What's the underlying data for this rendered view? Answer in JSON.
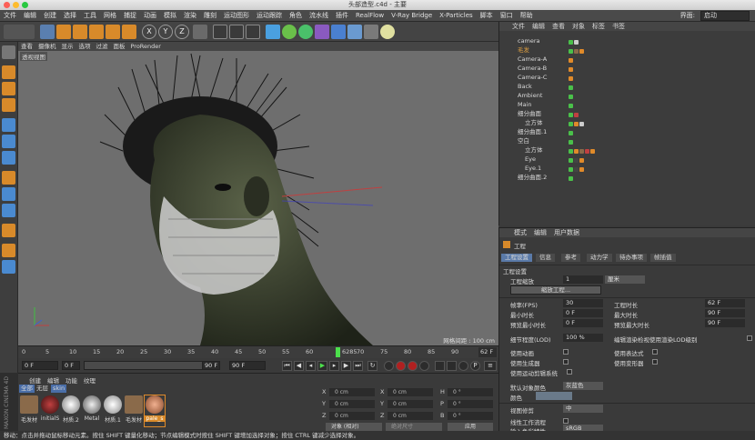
{
  "window": {
    "title": "头部造型.c4d - 主要"
  },
  "menu": {
    "items": [
      "文件",
      "编辑",
      "创建",
      "选择",
      "工具",
      "网格",
      "捕捉",
      "动画",
      "模拟",
      "渲染",
      "雕刻",
      "运动图形",
      "运动跟踪",
      "角色",
      "流水线",
      "插件",
      "RealFlow",
      "V-Ray Bridge",
      "X-Particles",
      "脚本",
      "窗口",
      "帮助"
    ],
    "interface_label": "界面:",
    "interface_value": "启动"
  },
  "viewport": {
    "menu": [
      "查看",
      "摄像机",
      "显示",
      "选项",
      "过滤",
      "面板",
      "ProRender"
    ],
    "label": "透视视图",
    "grid_label": "网格间距 : 100 cm"
  },
  "timeline": {
    "ticks": [
      "0",
      "5",
      "10",
      "15",
      "20",
      "25",
      "30",
      "35",
      "40",
      "45",
      "50",
      "55",
      "60",
      "65",
      "70",
      "75",
      "80",
      "85",
      "90"
    ],
    "current_frame": "6285",
    "end_frame": "62 F"
  },
  "transport": {
    "start_field": "0 F",
    "min_field": "0 F",
    "max_field": "90 F",
    "end_field": "90 F"
  },
  "material_panel": {
    "menu": [
      "创建",
      "编辑",
      "功能",
      "纹理"
    ],
    "filters": [
      "全部",
      "无层",
      "skin"
    ],
    "materials": [
      {
        "name": "毛发材",
        "color": "#8a6a4a"
      },
      {
        "name": "initialS",
        "color": "#7a2a2a"
      },
      {
        "name": "材质.2",
        "color": "#bdbdbd"
      },
      {
        "name": "Metal",
        "color": "#9a9a9a"
      },
      {
        "name": "材质.1",
        "color": "#cfcfcf"
      },
      {
        "name": "毛发材",
        "color": "#8a6a4a"
      },
      {
        "name": "pale_s",
        "color": "#c98a6a"
      }
    ],
    "brand": "MAXON CINEMA 4D"
  },
  "coords": {
    "rows": [
      {
        "a": "X",
        "av": "0 cm",
        "b": "X",
        "bv": "0 cm",
        "c": "H",
        "cv": "0 °"
      },
      {
        "a": "Y",
        "av": "0 cm",
        "b": "Y",
        "bv": "0 cm",
        "c": "P",
        "cv": "0 °"
      },
      {
        "a": "Z",
        "av": "0 cm",
        "b": "Z",
        "bv": "0 cm",
        "c": "B",
        "cv": "0 °"
      }
    ],
    "mode_select": "对象 (相对)",
    "size_select": "绝对尺寸",
    "apply": "应用"
  },
  "object_manager": {
    "menu": [
      "文件",
      "编辑",
      "查看",
      "对象",
      "标签",
      "书签"
    ],
    "objects": [
      {
        "name": "camera",
        "depth": 0
      },
      {
        "name": "毛发",
        "depth": 0
      },
      {
        "name": "Camera-A",
        "depth": 0
      },
      {
        "name": "Camera-B",
        "depth": 0
      },
      {
        "name": "Camera-C",
        "depth": 0
      },
      {
        "name": "Back",
        "depth": 0
      },
      {
        "name": "Ambient",
        "depth": 0
      },
      {
        "name": "Main",
        "depth": 0
      },
      {
        "name": "细分曲面",
        "depth": 0
      },
      {
        "name": "立方体",
        "depth": 1
      },
      {
        "name": "细分曲面.1",
        "depth": 0
      },
      {
        "name": "空白",
        "depth": 0
      },
      {
        "name": "立方体",
        "depth": 1
      },
      {
        "name": "Eye",
        "depth": 1
      },
      {
        "name": "Eye.1",
        "depth": 1
      },
      {
        "name": "细分曲面.2",
        "depth": 0
      }
    ]
  },
  "attributes": {
    "menu": [
      "模式",
      "编辑",
      "用户数据"
    ],
    "section": "工程",
    "tabs": [
      "工程设置",
      "信息",
      "参考",
      "动力学",
      "待办事项",
      "帧插值"
    ],
    "group": "工程设置",
    "scale_label": "工程缩放",
    "scale_value": "1",
    "scale_unit": "厘米",
    "scale_button": "缩放工程...",
    "left": [
      {
        "label": "帧率(FPS)",
        "value": "30"
      },
      {
        "label": "最小时长",
        "value": "0 F"
      },
      {
        "label": "预览最小时长",
        "value": "0 F"
      },
      {
        "label": "细节程度(LOD)",
        "value": "100 %"
      }
    ],
    "right": [
      {
        "label": "工程时长",
        "value": "62 F"
      },
      {
        "label": "最大时长",
        "value": "90 F"
      },
      {
        "label": "预览最大时长",
        "value": "90 F"
      }
    ],
    "lod_check": "编辑渲染检视使用渲染LOD级别",
    "checks_left": [
      "使用动画",
      "使用生成器",
      "使用运动剪辑系统"
    ],
    "checks_right": [
      "使用表达式",
      "使用变形器"
    ],
    "default_color_label": "默认对象颜色",
    "default_color_value": "灰蓝色",
    "color_label": "颜色",
    "view_clip_label": "视图修剪",
    "view_clip_value": "中",
    "linear_label": "线性工作流程",
    "input_color_label": "输入色彩特性",
    "input_color_value": "sRGB"
  },
  "status": {
    "text": "移动：点击并拖动鼠标移动元素。按住 SHIFT 键量化移动；节点编辑模式时按住 SHIFT 键增加选择对象；按住 CTRL 键减少选择对象。"
  }
}
